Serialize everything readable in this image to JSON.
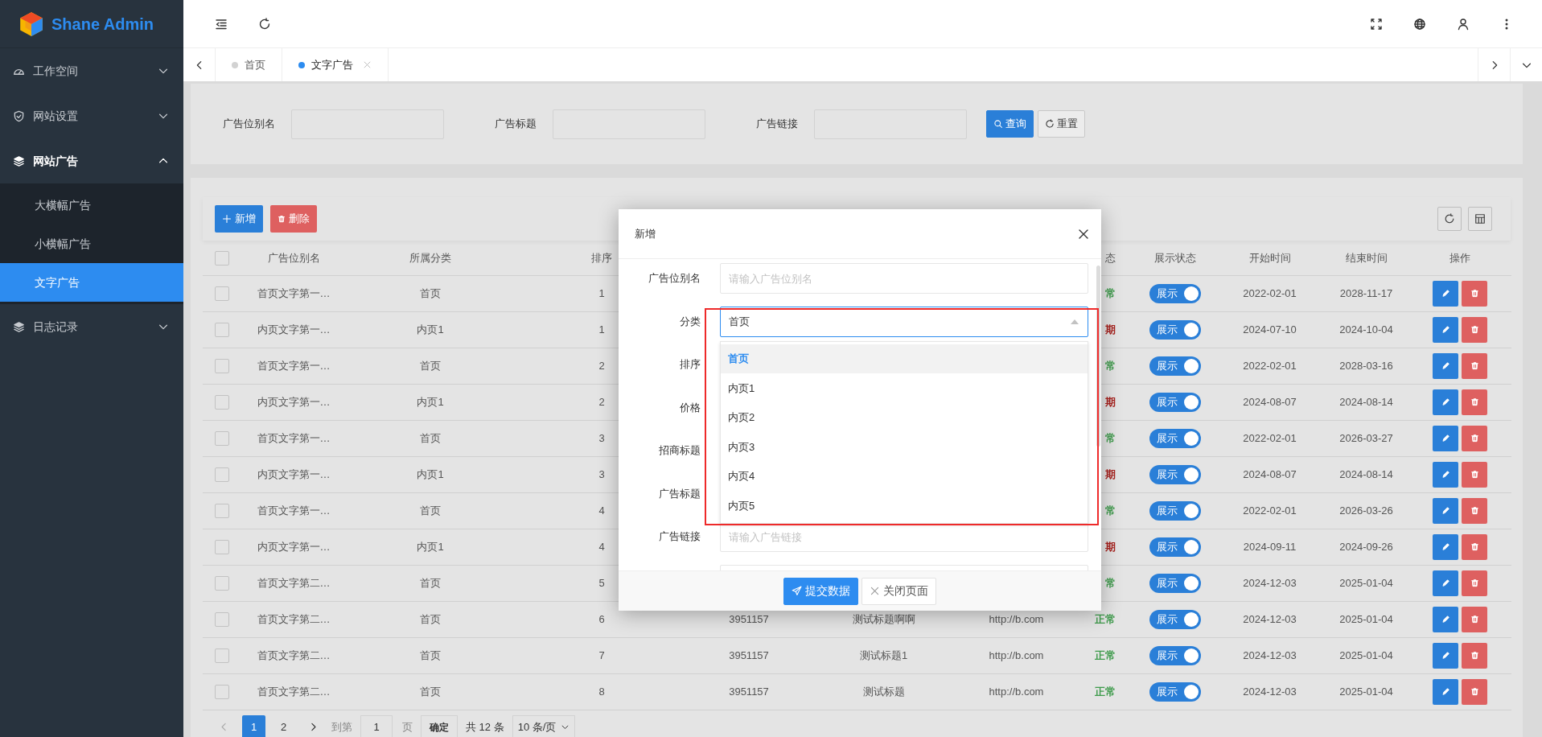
{
  "sidebar": {
    "brand": "Shane Admin",
    "menu": [
      {
        "label": "工作空间",
        "expanded": false
      },
      {
        "label": "网站设置",
        "expanded": false
      },
      {
        "label": "网站广告",
        "expanded": true,
        "children": [
          {
            "label": "大横幅广告",
            "selected": false
          },
          {
            "label": "小横幅广告",
            "selected": false
          },
          {
            "label": "文字广告",
            "selected": true
          }
        ]
      },
      {
        "label": "日志记录",
        "expanded": false
      }
    ]
  },
  "tabs": [
    {
      "label": "首页",
      "selected": false,
      "closable": false
    },
    {
      "label": "文字广告",
      "selected": true,
      "closable": true
    }
  ],
  "search_form": {
    "fields": [
      {
        "label": "广告位别名"
      },
      {
        "label": "广告标题"
      },
      {
        "label": "广告链接"
      }
    ],
    "buttons": [
      {
        "label": "查询",
        "kind": "primary"
      },
      {
        "label": "重置",
        "kind": "default"
      }
    ]
  },
  "toolbar": {
    "buttons": [
      {
        "label": "新增",
        "kind": "add"
      },
      {
        "label": "删除",
        "kind": "delete"
      }
    ]
  },
  "table": {
    "select_all_checked": false,
    "columns": [
      "广告位别名",
      "所属分类",
      "排序",
      null,
      null,
      null,
      "态",
      "展示状态",
      "开始时间",
      "结束时间",
      "操作"
    ],
    "rows": [
      {
        "checked": false,
        "cells": [
          "首页文字第一…",
          "首页",
          "1",
          null,
          null,
          null
        ],
        "status": {
          "text": "常",
          "kind": "normal"
        },
        "display": {
          "label": "展示",
          "on": true
        },
        "start": "2022-02-01",
        "end": "2028-11-17"
      },
      {
        "checked": false,
        "cells": [
          "内页文字第一…",
          "内页1",
          "1",
          null,
          null,
          null
        ],
        "status": {
          "text": "期",
          "kind": "expired"
        },
        "display": {
          "label": "展示",
          "on": true
        },
        "start": "2024-07-10",
        "end": "2024-10-04"
      },
      {
        "checked": false,
        "cells": [
          "首页文字第一…",
          "首页",
          "2",
          null,
          null,
          null
        ],
        "status": {
          "text": "常",
          "kind": "normal"
        },
        "display": {
          "label": "展示",
          "on": true
        },
        "start": "2022-02-01",
        "end": "2028-03-16"
      },
      {
        "checked": false,
        "cells": [
          "内页文字第一…",
          "内页1",
          "2",
          null,
          null,
          null
        ],
        "status": {
          "text": "期",
          "kind": "expired"
        },
        "display": {
          "label": "展示",
          "on": true
        },
        "start": "2024-08-07",
        "end": "2024-08-14"
      },
      {
        "checked": false,
        "cells": [
          "首页文字第一…",
          "首页",
          "3",
          null,
          null,
          null
        ],
        "status": {
          "text": "常",
          "kind": "normal"
        },
        "display": {
          "label": "展示",
          "on": true
        },
        "start": "2022-02-01",
        "end": "2026-03-27"
      },
      {
        "checked": false,
        "cells": [
          "内页文字第一…",
          "内页1",
          "3",
          null,
          null,
          null
        ],
        "status": {
          "text": "期",
          "kind": "expired"
        },
        "display": {
          "label": "展示",
          "on": true
        },
        "start": "2024-08-07",
        "end": "2024-08-14"
      },
      {
        "checked": false,
        "cells": [
          "首页文字第一…",
          "首页",
          "4",
          null,
          null,
          null
        ],
        "status": {
          "text": "常",
          "kind": "normal"
        },
        "display": {
          "label": "展示",
          "on": true
        },
        "start": "2022-02-01",
        "end": "2026-03-26"
      },
      {
        "checked": false,
        "cells": [
          "内页文字第一…",
          "内页1",
          "4",
          null,
          null,
          null
        ],
        "status": {
          "text": "期",
          "kind": "expired"
        },
        "display": {
          "label": "展示",
          "on": true
        },
        "start": "2024-09-11",
        "end": "2024-09-26"
      },
      {
        "checked": false,
        "cells": [
          "首页文字第二…",
          "首页",
          "5",
          null,
          null,
          null
        ],
        "status": {
          "text": "常",
          "kind": "normal"
        },
        "display": {
          "label": "展示",
          "on": true
        },
        "start": "2024-12-03",
        "end": "2025-01-04"
      },
      {
        "checked": false,
        "cells": [
          "首页文字第二…",
          "首页",
          "6",
          "3951157",
          "测试标题啊啊",
          "http://b.com"
        ],
        "status": {
          "text": "正常",
          "kind": "normal"
        },
        "display": {
          "label": "展示",
          "on": true
        },
        "start": "2024-12-03",
        "end": "2025-01-04"
      },
      {
        "checked": false,
        "cells": [
          "首页文字第二…",
          "首页",
          "7",
          "3951157",
          "测试标题1",
          "http://b.com"
        ],
        "status": {
          "text": "正常",
          "kind": "normal"
        },
        "display": {
          "label": "展示",
          "on": true
        },
        "start": "2024-12-03",
        "end": "2025-01-04"
      },
      {
        "checked": false,
        "cells": [
          "首页文字第二…",
          "首页",
          "8",
          "3951157",
          "测试标题",
          "http://b.com"
        ],
        "status": {
          "text": "正常",
          "kind": "normal"
        },
        "display": {
          "label": "展示",
          "on": true
        },
        "start": "2024-12-03",
        "end": "2025-01-04"
      }
    ]
  },
  "pagination": {
    "pages": [
      {
        "label": "1",
        "selected": true
      },
      {
        "label": "2",
        "selected": false
      }
    ],
    "goto_label": "到第",
    "goto_value": "1",
    "page_unit": "页",
    "confirm": "确定",
    "total": "共 12 条",
    "page_size": "10 条/页"
  },
  "modal": {
    "title": "新增",
    "fields": [
      {
        "kind": "input",
        "label": "广告位别名",
        "placeholder": "请输入广告位别名"
      },
      {
        "kind": "select",
        "label": "分类",
        "value": "首页",
        "open": true,
        "options": [
          {
            "label": "首页",
            "selected": true
          },
          {
            "label": "内页1",
            "selected": false
          },
          {
            "label": "内页2",
            "selected": false
          },
          {
            "label": "内页3",
            "selected": false
          },
          {
            "label": "内页4",
            "selected": false
          },
          {
            "label": "内页5",
            "selected": false
          }
        ]
      },
      {
        "kind": "input",
        "label": "排序"
      },
      {
        "kind": "input",
        "label": "价格"
      },
      {
        "kind": "input",
        "label": "招商标题"
      },
      {
        "kind": "input",
        "label": "广告标题"
      },
      {
        "kind": "input",
        "label": "广告链接",
        "placeholder": "请输入广告链接"
      },
      {
        "kind": "input"
      }
    ],
    "buttons": [
      {
        "label": "提交数据",
        "kind": "primary"
      },
      {
        "label": "关闭页面",
        "kind": "default"
      }
    ]
  },
  "annotation_box": true
}
